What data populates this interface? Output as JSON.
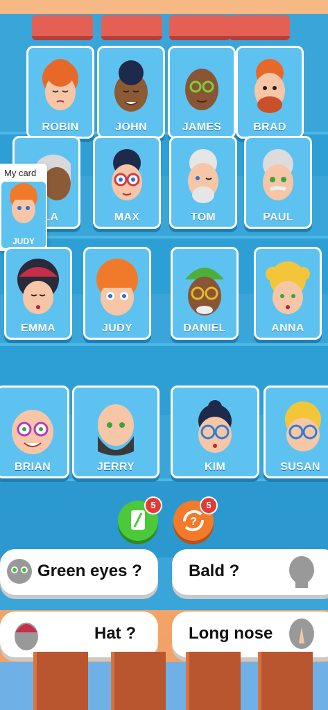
{
  "my_card": {
    "label": "My card",
    "name": "JUDY"
  },
  "rows": [
    [
      "ROBIN",
      "JOHN",
      "JAMES",
      "BRAD"
    ],
    [
      "OLA",
      "MAX",
      "TOM",
      "PAUL"
    ],
    [
      "EMMA",
      "JUDY",
      "DANIEL",
      "ANNA"
    ],
    [
      "BRIAN",
      "JERRY",
      "KIM",
      "SUSAN"
    ]
  ],
  "actions": {
    "guess_badge": "5",
    "swap_badge": "5"
  },
  "questions": {
    "green_eyes": "Green eyes ?",
    "bald": "Bald ?",
    "hat": "Hat ?",
    "long_nose": "Long nose"
  },
  "colors": {
    "card": "#5ec2f0",
    "board": "#3aa5d8",
    "green_action": "#4cc93a",
    "orange_action": "#f47a2b",
    "badge": "#e53935"
  }
}
